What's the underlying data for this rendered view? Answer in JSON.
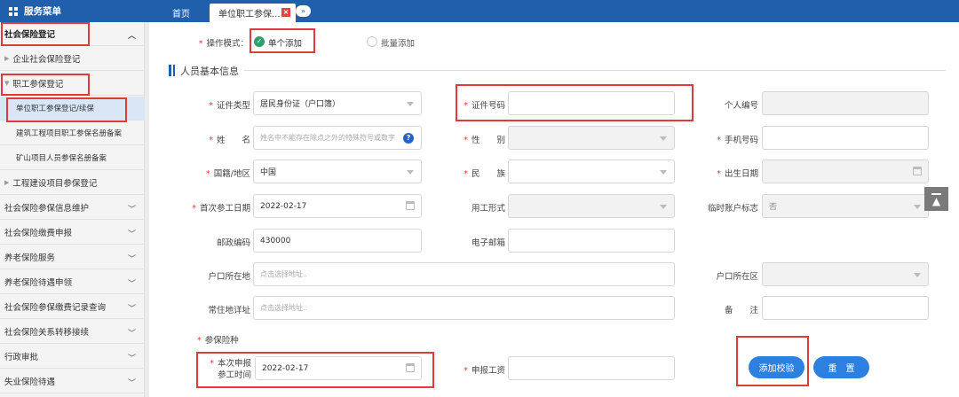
{
  "topbar": {
    "menu_title": "服务菜单",
    "tabs": [
      {
        "label": "首页"
      },
      {
        "label": "单位职工参保..."
      }
    ],
    "close_glyph": "×",
    "more_glyph": "»"
  },
  "sidebar": {
    "items": [
      {
        "label": "社会保险登记",
        "icon": "chevron-up-icon"
      },
      {
        "label": "企业社会保险登记",
        "icon": "triangle-right-icon"
      },
      {
        "label": "职工参保登记",
        "icon": "triangle-down-icon"
      },
      {
        "label": "单位职工参保登记/续保"
      },
      {
        "label": "建筑工程项目职工参保名册备案"
      },
      {
        "label": "矿山项目人员参保名册备案"
      },
      {
        "label": "工程建设项目参保登记",
        "icon": "triangle-right-icon"
      },
      {
        "label": "社会保险参保信息维护",
        "icon": "chevron-down-icon"
      },
      {
        "label": "社会保险缴费申报",
        "icon": "chevron-down-icon"
      },
      {
        "label": "养老保险服务",
        "icon": "chevron-down-icon"
      },
      {
        "label": "养老保险待遇申领",
        "icon": "chevron-down-icon"
      },
      {
        "label": "社会保险参保缴费记录查询",
        "icon": "chevron-down-icon"
      },
      {
        "label": "社会保险关系转移接续",
        "icon": "chevron-down-icon"
      },
      {
        "label": "行政审批",
        "icon": "chevron-down-icon"
      },
      {
        "label": "失业保险待遇",
        "icon": "chevron-down-icon"
      }
    ]
  },
  "form": {
    "mode_label": "操作模式：",
    "mode_single": "单个添加",
    "mode_batch": "批量添加",
    "section_title": "人员基本信息",
    "id_type_label": "证件类型",
    "id_type_value": "居民身份证（户口簿）",
    "id_number_label": "证件号码",
    "id_number_value": "",
    "person_no_label": "个人编号",
    "name_label": "姓　　名",
    "name_placeholder": "姓名中不能存在除点之外的特殊符号或数字",
    "help_glyph": "?",
    "gender_label": "性　　别",
    "phone_label": "手机号码",
    "nationality_label": "国籍/地区",
    "nationality_value": "中国",
    "ethnicity_label": "民　　族",
    "birth_label": "出生日期",
    "first_work_label": "首次参工日期",
    "first_work_value": "2022-02-17",
    "employment_label": "用工形式",
    "temp_account_label": "临时账户标志",
    "temp_account_value": "否",
    "postcode_label": "邮政编码",
    "postcode_value": "430000",
    "email_label": "电子邮箱",
    "hukou_addr_label": "户口所在地",
    "hukou_addr_placeholder": "点击选择地址..",
    "hukou_district_label": "户口所在区",
    "residence_label": "常住地详址",
    "residence_placeholder": "点击选择地址..",
    "remark_label": "备　　注",
    "insurance_type_label": "参保险种",
    "declare_time_label_1": "本次申报",
    "declare_time_label_2": "参工时间",
    "declare_time_value": "2022-02-17",
    "declare_wage_label": "申报工资",
    "btn_validate": "添加校验",
    "btn_reset": "重　置"
  },
  "colors": {
    "topbar": "#1f5fab",
    "highlight": "#e03b3b",
    "primary_button": "#2e80e0",
    "required": "#e23b3b"
  }
}
